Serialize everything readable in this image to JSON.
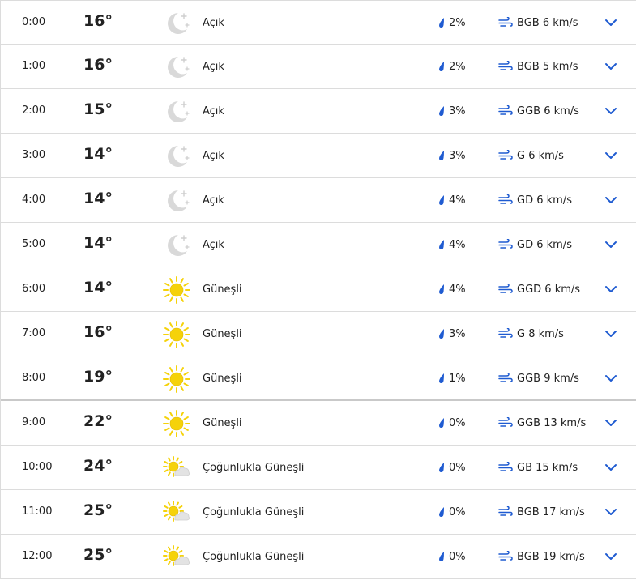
{
  "colors": {
    "accent": "#1f5bd1",
    "sun": "#f5d20a",
    "moon": "#d9d9d9",
    "divider": "#dcdcdc"
  },
  "rows": [
    {
      "time": "0:00",
      "temp": "16°",
      "icon": "moon-clear-icon",
      "condition": "Açık",
      "precip": "2%",
      "wind": "BGB 6 km/s"
    },
    {
      "time": "1:00",
      "temp": "16°",
      "icon": "moon-clear-icon",
      "condition": "Açık",
      "precip": "2%",
      "wind": "BGB 5 km/s"
    },
    {
      "time": "2:00",
      "temp": "15°",
      "icon": "moon-clear-icon",
      "condition": "Açık",
      "precip": "3%",
      "wind": "GGB 6 km/s"
    },
    {
      "time": "3:00",
      "temp": "14°",
      "icon": "moon-clear-icon",
      "condition": "Açık",
      "precip": "3%",
      "wind": "G 6 km/s"
    },
    {
      "time": "4:00",
      "temp": "14°",
      "icon": "moon-clear-icon",
      "condition": "Açık",
      "precip": "4%",
      "wind": "GD 6 km/s"
    },
    {
      "time": "5:00",
      "temp": "14°",
      "icon": "moon-clear-icon",
      "condition": "Açık",
      "precip": "4%",
      "wind": "GD 6 km/s"
    },
    {
      "time": "6:00",
      "temp": "14°",
      "icon": "sun-icon",
      "condition": "Güneşli",
      "precip": "4%",
      "wind": "GGD 6 km/s"
    },
    {
      "time": "7:00",
      "temp": "16°",
      "icon": "sun-icon",
      "condition": "Güneşli",
      "precip": "3%",
      "wind": "G 8 km/s"
    },
    {
      "time": "8:00",
      "temp": "19°",
      "icon": "sun-icon",
      "condition": "Güneşli",
      "precip": "1%",
      "wind": "GGB 9 km/s"
    },
    {
      "time": "9:00",
      "temp": "22°",
      "icon": "sun-icon",
      "condition": "Güneşli",
      "precip": "0%",
      "wind": "GGB 13 km/s"
    },
    {
      "time": "10:00",
      "temp": "24°",
      "icon": "sun-cloud-icon",
      "condition": "Çoğunlukla Güneşli",
      "precip": "0%",
      "wind": "GB 15 km/s"
    },
    {
      "time": "11:00",
      "temp": "25°",
      "icon": "sun-cloud-icon",
      "condition": "Çoğunlukla Güneşli",
      "precip": "0%",
      "wind": "BGB 17 km/s"
    },
    {
      "time": "12:00",
      "temp": "25°",
      "icon": "sun-cloud-icon",
      "condition": "Çoğunlukla Güneşli",
      "precip": "0%",
      "wind": "BGB 19 km/s"
    }
  ]
}
